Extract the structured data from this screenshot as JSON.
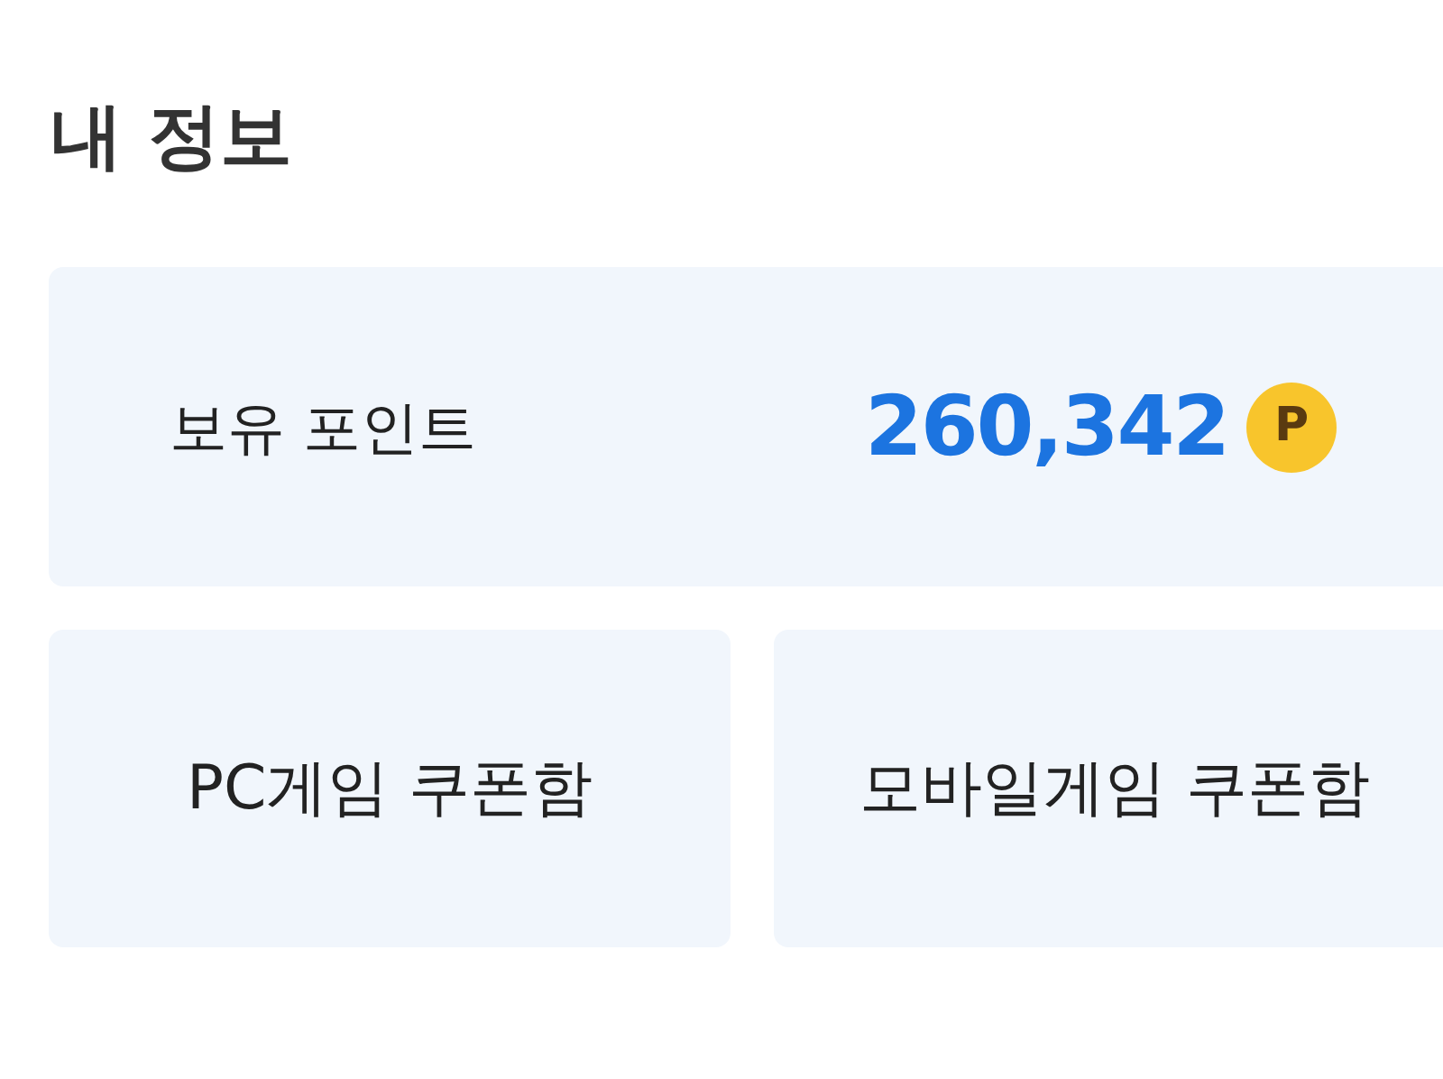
{
  "title": "내 정보",
  "points": {
    "label": "보유 포인트",
    "value": "260,342",
    "coin": "P"
  },
  "coupon_boxes": [
    {
      "label": "PC게임 쿠폰함"
    },
    {
      "label": "모바일게임 쿠폰함"
    }
  ]
}
